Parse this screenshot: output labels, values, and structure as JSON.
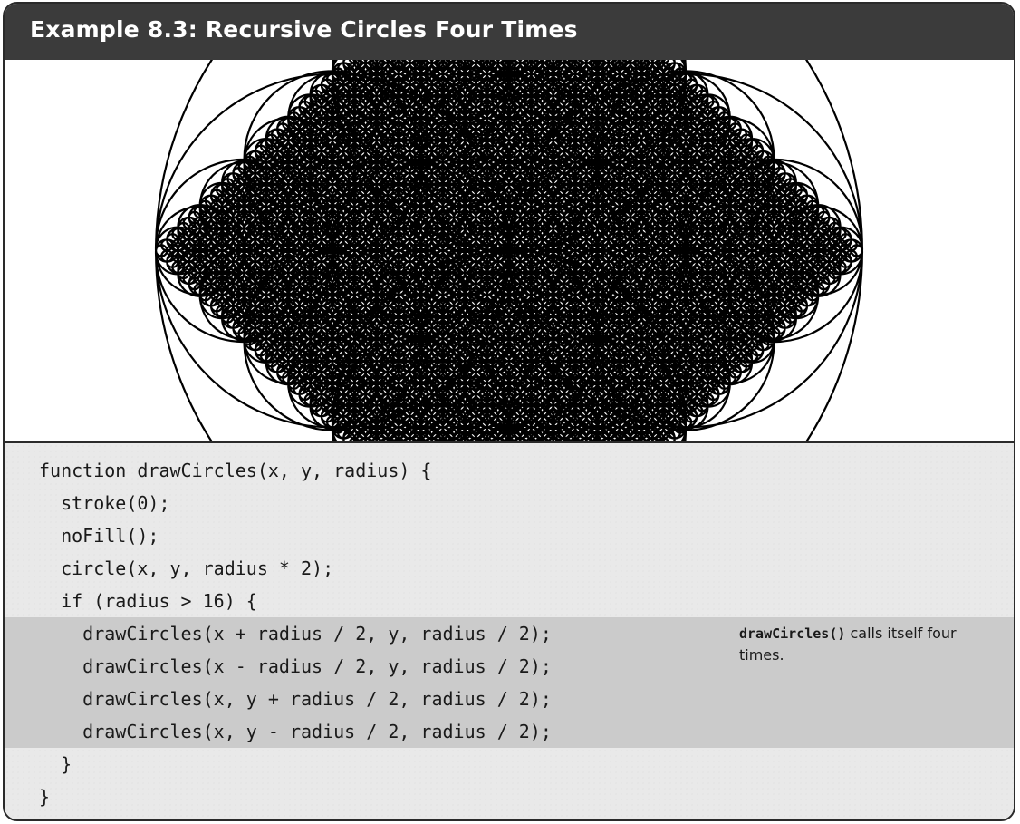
{
  "header": {
    "title": "Example 8.3: Recursive Circles Four Times"
  },
  "sketch": {
    "stroke_color": "#000000",
    "fill": "none",
    "min_radius": 16
  },
  "code": {
    "lines": [
      "function drawCircles(x, y, radius) {",
      "  stroke(0);",
      "  noFill();",
      "  circle(x, y, radius * 2);",
      "  if (radius > 16) {",
      "    drawCircles(x + radius / 2, y, radius / 2);",
      "    drawCircles(x - radius / 2, y, radius / 2);",
      "    drawCircles(x, y + radius / 2, radius / 2);",
      "    drawCircles(x, y - radius / 2, radius / 2);",
      "  }",
      "}"
    ]
  },
  "annotation": {
    "function_name": "drawCircles()",
    "text": " calls itself four times."
  },
  "colors": {
    "header_bg": "#3b3b3b",
    "code_bg": "#e9e9e9",
    "highlight_bg": "#cbcbcb"
  }
}
